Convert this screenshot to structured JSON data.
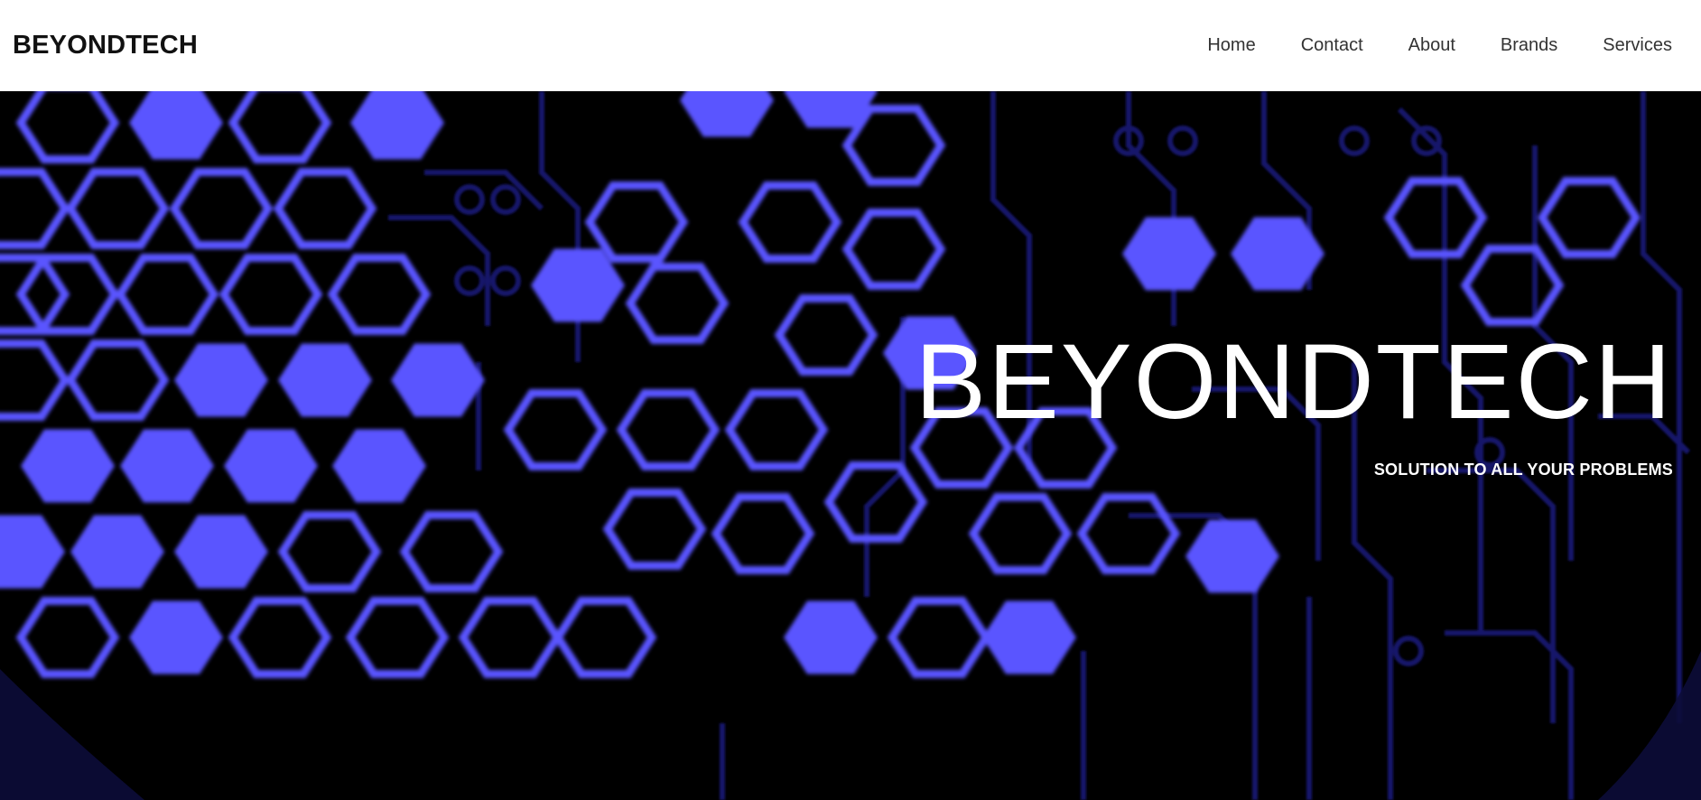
{
  "navbar": {
    "brand": "BEYONDTECH",
    "links": [
      {
        "label": "Home"
      },
      {
        "label": "Contact"
      },
      {
        "label": "About"
      },
      {
        "label": "Brands"
      },
      {
        "label": "Services"
      }
    ]
  },
  "hero": {
    "title": "BEYONDTECH",
    "subtitle": "SOLUTION TO ALL YOUR PROBLEMS"
  },
  "colors": {
    "hex_accent": "#5a55ff",
    "circuit": "#16166a",
    "background": "#000000",
    "navbar_bg": "#ffffff"
  }
}
